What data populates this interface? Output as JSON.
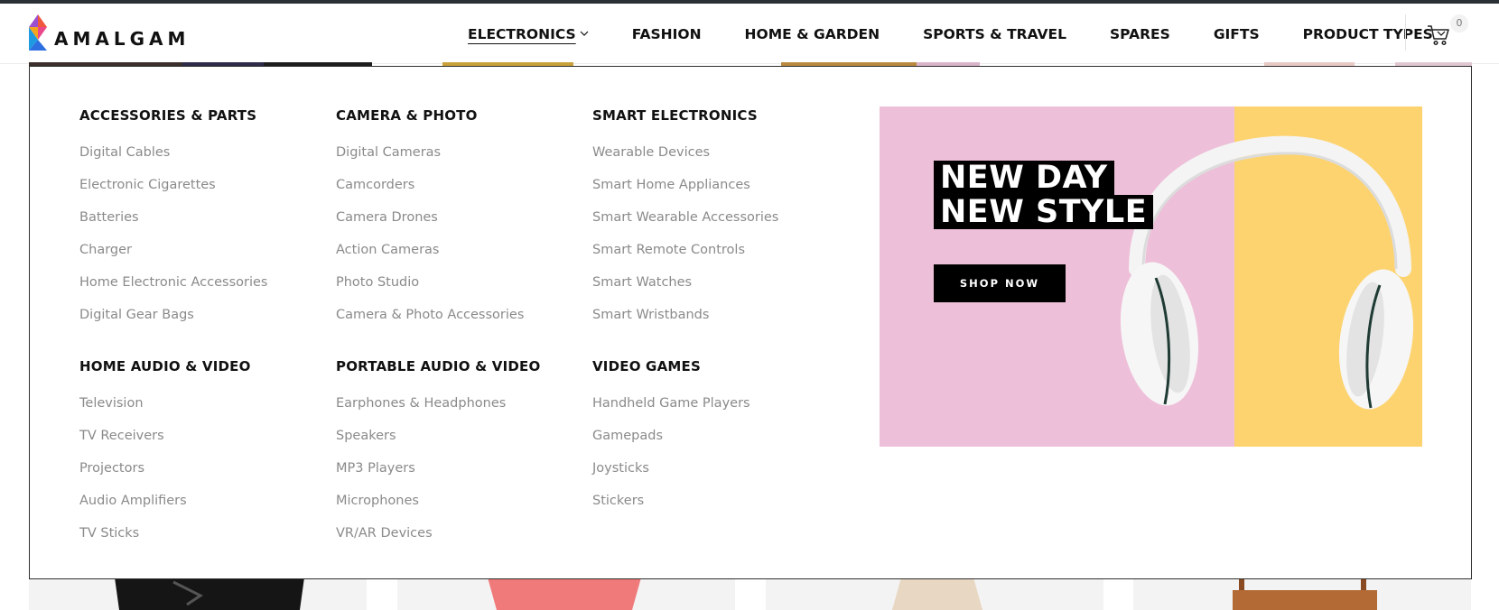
{
  "brand": {
    "name": "AMALGAM"
  },
  "nav": {
    "items": [
      {
        "label": "ELECTRONICS",
        "dropdown": true,
        "active": true
      },
      {
        "label": "FASHION",
        "dropdown": false
      },
      {
        "label": "HOME & GARDEN",
        "dropdown": false
      },
      {
        "label": "SPORTS & TRAVEL",
        "dropdown": false
      },
      {
        "label": "SPARES",
        "dropdown": false
      },
      {
        "label": "GIFTS",
        "dropdown": false
      },
      {
        "label": "PRODUCT TYPES",
        "dropdown": true
      }
    ],
    "cart_count": "0",
    "cart_icon": "cart-icon"
  },
  "mega_menu": {
    "columns": [
      {
        "title": "ACCESSORIES & PARTS",
        "items": [
          "Digital Cables",
          "Electronic Cigarettes",
          "Batteries",
          "Charger",
          "Home Electronic Accessories",
          "Digital Gear Bags"
        ]
      },
      {
        "title": "CAMERA & PHOTO",
        "items": [
          "Digital Cameras",
          "Camcorders",
          "Camera Drones",
          "Action Cameras",
          "Photo Studio",
          "Camera & Photo Accessories"
        ]
      },
      {
        "title": "SMART ELECTRONICS",
        "items": [
          "Wearable Devices",
          "Smart Home Appliances",
          "Smart Wearable Accessories",
          "Smart Remote Controls",
          "Smart Watches",
          "Smart Wristbands"
        ]
      },
      {
        "title": "HOME AUDIO & VIDEO",
        "items": [
          "Television",
          "TV Receivers",
          "Projectors",
          "Audio Amplifiers",
          "TV Sticks"
        ]
      },
      {
        "title": "PORTABLE AUDIO & VIDEO",
        "items": [
          "Earphones & Headphones",
          "Speakers",
          "MP3 Players",
          "Microphones",
          "VR/AR Devices"
        ]
      },
      {
        "title": "VIDEO GAMES",
        "items": [
          "Handheld Game Players",
          "Gamepads",
          "Joysticks",
          "Stickers"
        ]
      }
    ],
    "banner": {
      "headline_line1": "NEW DAY",
      "headline_line2": "NEW STYLE",
      "button_label": "SHOP NOW",
      "colors": {
        "pink": "#eebfd9",
        "yellow": "#fdd36f"
      }
    }
  },
  "colors": {
    "accent_dark": "#111111",
    "link_gray": "#8a8a8a",
    "top_bar": "#2b3034"
  }
}
